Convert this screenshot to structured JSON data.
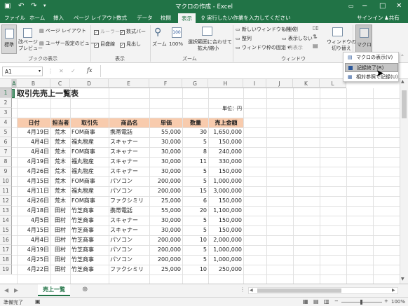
{
  "app": {
    "doc_title": "マクロの作成 - Excel",
    "signin": "サインイン",
    "share": "共有"
  },
  "tabs": [
    "ファイル",
    "ホーム",
    "挿入",
    "ページ レイアウト",
    "数式",
    "データ",
    "校閲",
    "表示"
  ],
  "tellme": "実行したい作業を入力してください",
  "ribbon": {
    "workbook_views": {
      "normal": "標準",
      "pagebreak": "改ページ\nプレビュー",
      "page_layout": "ページ レイアウト",
      "custom": "ユーザー設定のビュー",
      "caption": "ブックの表示"
    },
    "show": {
      "ruler": "ルーラー",
      "gridlines": "目盛線",
      "formula_bar": "数式バー",
      "headings": "見出し",
      "caption": "表示",
      "ruler_checked": true,
      "gridlines_checked": true,
      "formula_bar_checked": true,
      "headings_checked": true
    },
    "zoom": {
      "zoom": "ズーム",
      "hundred": "100%",
      "selection": "選択範囲に合わせて\n拡大/縮小",
      "caption": "ズーム"
    },
    "window": {
      "new_window": "新しいウィンドウを開く",
      "arrange": "整列",
      "freeze": "ウィンドウ枠の固定",
      "split": "分割",
      "hide": "表示しない",
      "unhide": "再表示",
      "switch": "ウィンドウの\n切り替え",
      "caption": "ウィンドウ"
    },
    "macros": {
      "label": "マクロ"
    }
  },
  "macro_menu": {
    "view": "マクロの表示(V)",
    "stop": "記録終了(R)",
    "relative": "相対参照で記録(U)"
  },
  "formula_bar": {
    "name_box": "A1",
    "formula": ""
  },
  "columns": [
    "A",
    "B",
    "C",
    "D",
    "E",
    "F",
    "G",
    "H",
    "I",
    "J",
    "K",
    "L"
  ],
  "rows": [
    "1",
    "2",
    "3",
    "4",
    "5",
    "6",
    "7",
    "8",
    "9",
    "10",
    "11",
    "12",
    "13",
    "14",
    "15",
    "16",
    "17",
    "18",
    "19"
  ],
  "sheet": {
    "title": "取引先売上一覧表",
    "unit": "単位：円",
    "headers": [
      "日付",
      "担当者",
      "取引先",
      "商品名",
      "単価",
      "数量",
      "売上金額"
    ],
    "header_color": "#f8cbad",
    "data": [
      [
        "4月19日",
        "荒木",
        "FOM商事",
        "携帯電話",
        "55,000",
        "30",
        "1,650,000"
      ],
      [
        "4月4日",
        "荒木",
        "福丸物産",
        "スキャナー",
        "30,000",
        "5",
        "150,000"
      ],
      [
        "4月4日",
        "荒木",
        "FOM商事",
        "スキャナー",
        "30,000",
        "8",
        "240,000"
      ],
      [
        "4月19日",
        "荒木",
        "福丸物産",
        "スキャナー",
        "30,000",
        "11",
        "330,000"
      ],
      [
        "4月26日",
        "荒木",
        "福丸物産",
        "スキャナー",
        "30,000",
        "5",
        "150,000"
      ],
      [
        "4月15日",
        "荒木",
        "FOM商事",
        "パソコン",
        "200,000",
        "5",
        "1,000,000"
      ],
      [
        "4月11日",
        "荒木",
        "福丸物産",
        "パソコン",
        "200,000",
        "15",
        "3,000,000"
      ],
      [
        "4月26日",
        "荒木",
        "FOM商事",
        "ファクシミリ",
        "25,000",
        "6",
        "150,000"
      ],
      [
        "4月18日",
        "田村",
        "竹芝商事",
        "携帯電話",
        "55,000",
        "20",
        "1,100,000"
      ],
      [
        "4月5日",
        "田村",
        "竹芝商事",
        "スキャナー",
        "30,000",
        "5",
        "150,000"
      ],
      [
        "4月15日",
        "田村",
        "竹芝商事",
        "スキャナー",
        "30,000",
        "5",
        "150,000"
      ],
      [
        "4月4日",
        "田村",
        "竹芝商事",
        "パソコン",
        "200,000",
        "10",
        "2,000,000"
      ],
      [
        "4月19日",
        "田村",
        "竹芝商事",
        "パソコン",
        "200,000",
        "5",
        "1,000,000"
      ],
      [
        "4月25日",
        "田村",
        "竹芝商事",
        "パソコン",
        "200,000",
        "5",
        "1,000,000"
      ],
      [
        "4月22日",
        "田村",
        "竹芝商事",
        "ファクシミリ",
        "25,000",
        "10",
        "250,000"
      ]
    ]
  },
  "sheet_tab": "売上一覧",
  "status": {
    "ready": "準備完了",
    "zoom": "100%"
  }
}
